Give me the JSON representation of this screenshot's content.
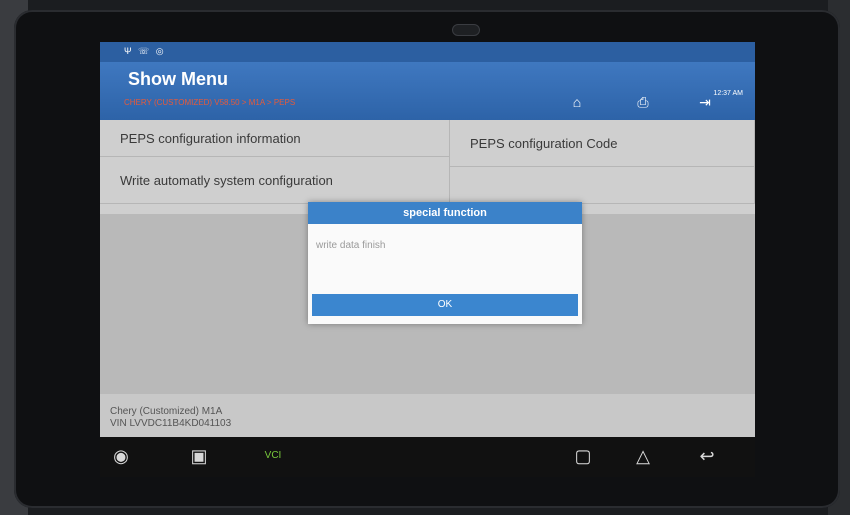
{
  "status_bar": {
    "icons": "Ψ ☏ ◎",
    "time": "12:37 AM"
  },
  "header": {
    "title": "Show Menu",
    "breadcrumb": "CHERY (CUSTOMIZED) V58.50 > M1A > PEPS",
    "home_icon": "house",
    "print_icon": "printer",
    "exit_icon": "exit-door"
  },
  "menu": {
    "items": [
      {
        "label": "PEPS configuration information"
      },
      {
        "label": "PEPS configuration Code"
      },
      {
        "label": "Write automatly system configuration"
      }
    ]
  },
  "dialog": {
    "title": "special function",
    "message": "write data finish",
    "ok_label": "OK"
  },
  "vehicle": {
    "name": "Chery (Customized) M1A",
    "vin": "VIN LVVDC11B4KD041103"
  },
  "navbar": {
    "browser_icon": "chrome",
    "gallery_icon": "screenshot",
    "vci_label": "VCI",
    "recent_icon": "recents",
    "home_icon": "home",
    "back_icon": "back"
  },
  "colors": {
    "header_blue": "#2d63a8",
    "dialog_blue": "#3b82c9",
    "breadcrumb_orange": "#e65a3a",
    "vci_green": "#79c93c"
  }
}
